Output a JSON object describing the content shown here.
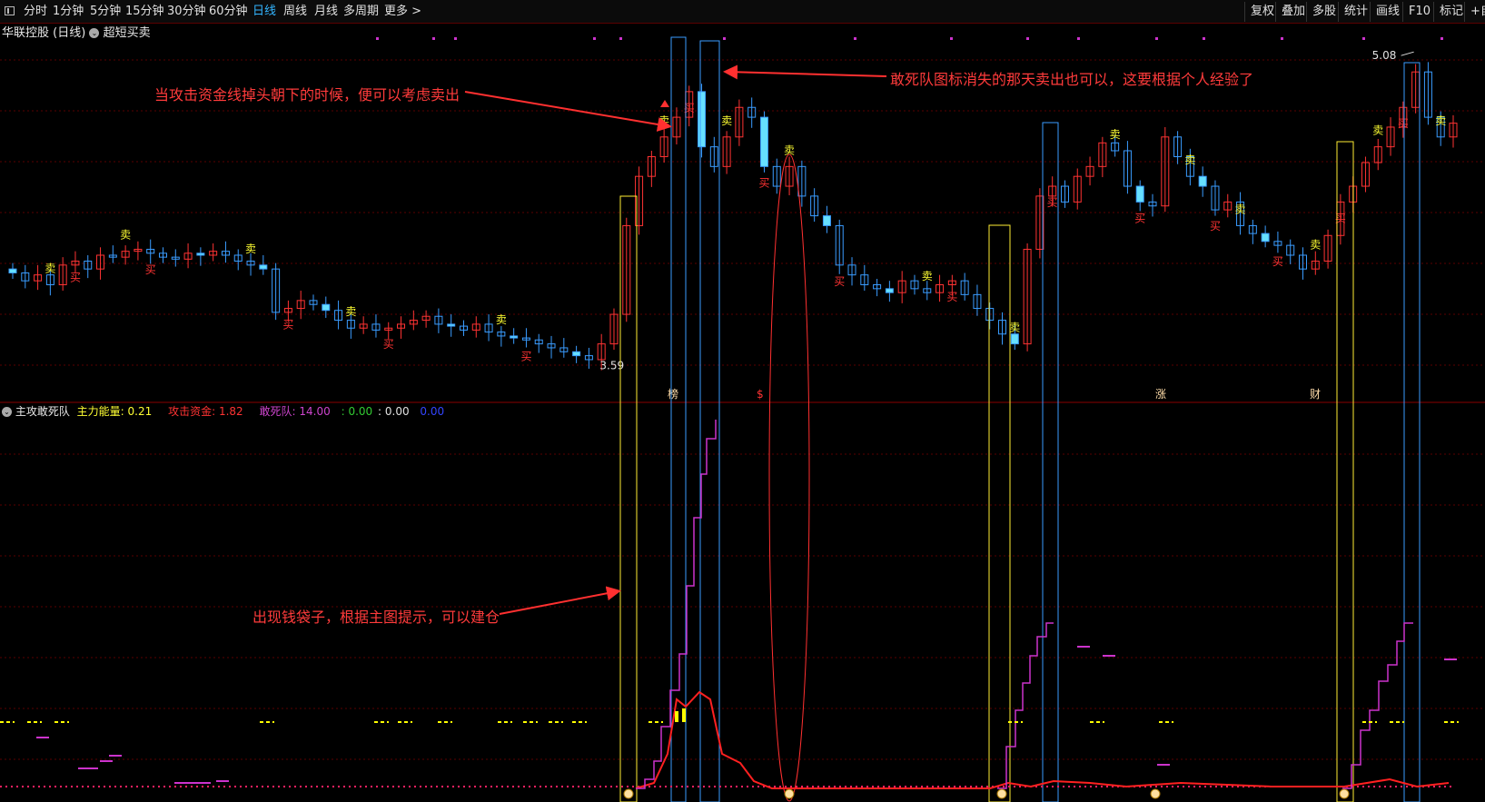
{
  "toolbar": {
    "periods": [
      "分时",
      "1分钟",
      "5分钟",
      "15分钟",
      "30分钟",
      "60分钟",
      "日线",
      "周线",
      "月线",
      "多周期",
      "更多 >"
    ],
    "active_period": "日线",
    "right_items": [
      "复权",
      "叠加",
      "多股",
      "统计",
      "画线",
      "F10",
      "标记",
      "+自"
    ]
  },
  "chart_header": {
    "stock_name": "华联控股 (日线)",
    "indicator_name": "超短买卖"
  },
  "price_labels": {
    "high": "5.08",
    "low": "3.59"
  },
  "event_markers": [
    "榜",
    "$",
    "涨",
    "财"
  ],
  "signals": {
    "buy": "买",
    "sell": "卖"
  },
  "indicator_header": {
    "name": "主攻敢死队",
    "main_energy_label": "主力能量:",
    "main_energy_value": "0.21",
    "attack_fund_label": "攻击资金:",
    "attack_fund_value": "1.82",
    "dare_label": "敢死队:",
    "dare_value": "14.00",
    "val1_label": ":",
    "val1": "0.00",
    "val2_label": ":",
    "val2": "0.00",
    "val3": "0.00"
  },
  "annotations": {
    "attack_line": "当攻击资金线掉头朝下的时候，便可以考虑卖出",
    "dare_icon": "敢死队图标消失的那天卖出也可以，这要根据个人经验了",
    "money_bag": "出现钱袋子，根据主图提示，可以建仓"
  },
  "colors": {
    "up": "#ff3333",
    "down": "#3a9cff",
    "down_solid": "#66e0ff",
    "grid": "#5a0000",
    "dare_line": "#cc33cc",
    "attack_line": "#ff2020",
    "energy": "#ffff00",
    "signal_buy": "#ff3333",
    "signal_sell": "#ffff33"
  },
  "chart_data": {
    "type": "candlestick",
    "ylim": [
      3.5,
      5.15
    ],
    "price_labels_shown": [
      5.08,
      3.59
    ],
    "candles_close_path": [
      4.06,
      4.02,
      4.05,
      4.0,
      4.1,
      4.12,
      4.08,
      4.15,
      4.14,
      4.17,
      4.18,
      4.16,
      4.14,
      4.13,
      4.16,
      4.15,
      4.17,
      4.15,
      4.12,
      4.1,
      4.08,
      3.86,
      3.88,
      3.92,
      3.9,
      3.87,
      3.82,
      3.78,
      3.8,
      3.77,
      3.78,
      3.8,
      3.82,
      3.84,
      3.8,
      3.79,
      3.77,
      3.8,
      3.76,
      3.74,
      3.73,
      3.72,
      3.7,
      3.68,
      3.66,
      3.64,
      3.62,
      3.7,
      3.85,
      4.3,
      4.55,
      4.65,
      4.75,
      4.85,
      4.98,
      4.7,
      4.6,
      4.75,
      4.9,
      4.85,
      4.6,
      4.5,
      4.6,
      4.45,
      4.35,
      4.3,
      4.1,
      4.05,
      4.0,
      3.98,
      3.96,
      4.02,
      3.98,
      3.96,
      4.0,
      4.02,
      3.95,
      3.88,
      3.82,
      3.75,
      3.7,
      4.18,
      4.45,
      4.5,
      4.42,
      4.55,
      4.6,
      4.72,
      4.68,
      4.5,
      4.42,
      4.4,
      4.75,
      4.65,
      4.55,
      4.5,
      4.38,
      4.42,
      4.3,
      4.26,
      4.22,
      4.2,
      4.15,
      4.08,
      4.12,
      4.25,
      4.42,
      4.5,
      4.62,
      4.7,
      4.8,
      4.9,
      5.08,
      4.85,
      4.75,
      4.82
    ]
  }
}
